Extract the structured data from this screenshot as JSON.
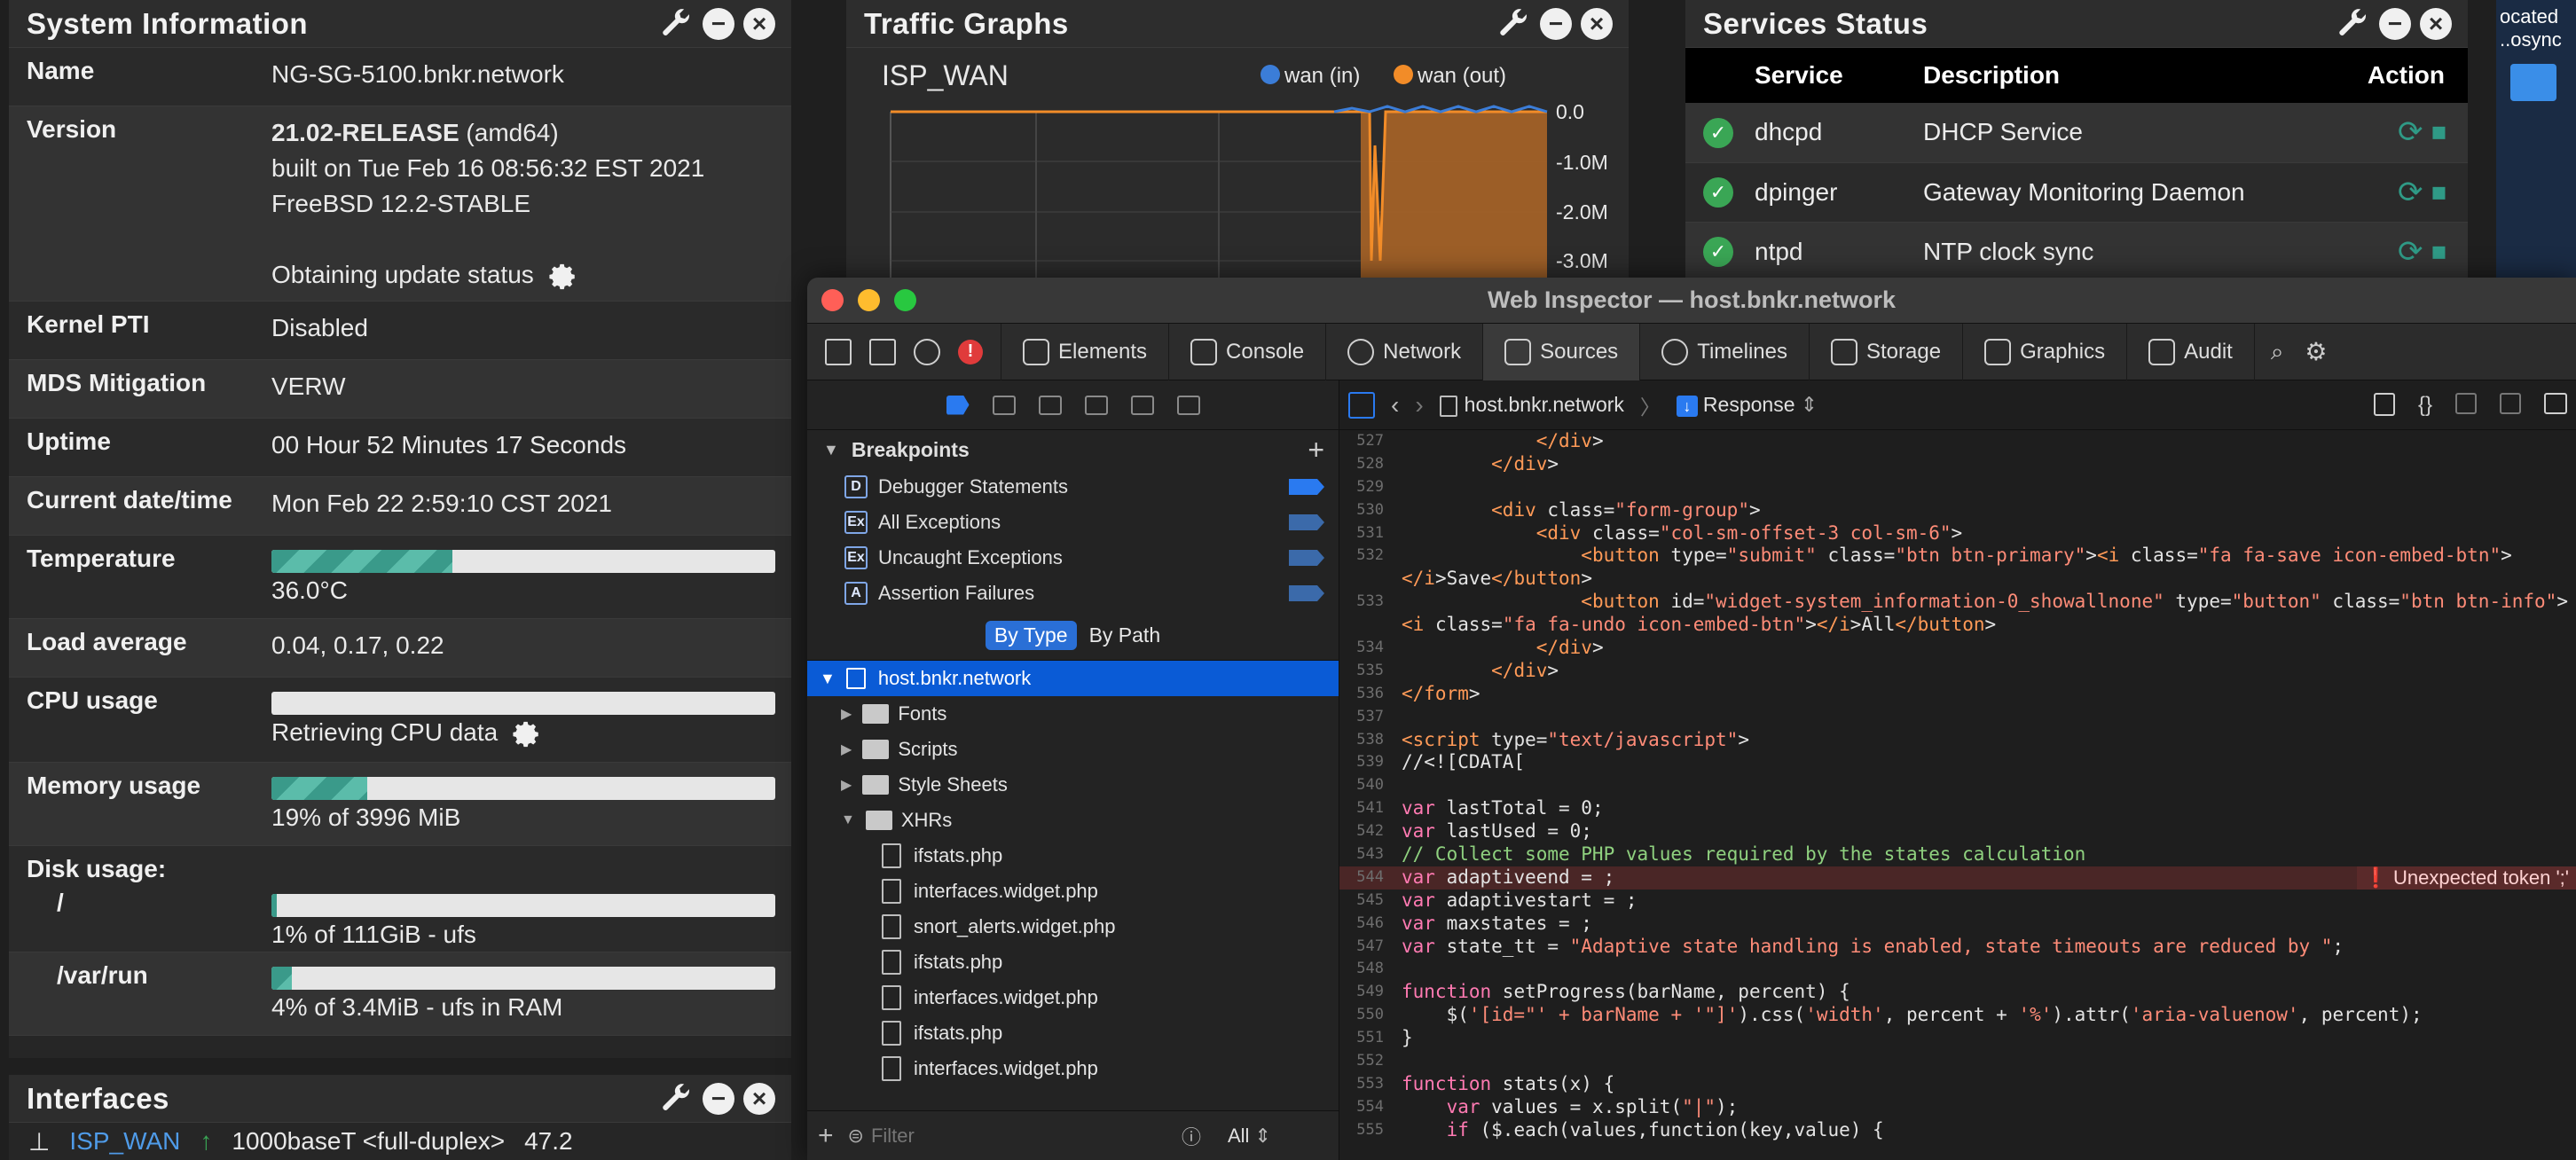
{
  "system_info": {
    "title": "System Information",
    "rows": [
      {
        "key": "Name",
        "value": "NG-SG-5100.bnkr.network"
      },
      {
        "key": "Version",
        "value_bold": "21.02-RELEASE",
        "value_suffix": " (amd64)",
        "line2": "built on Tue Feb 16 08:56:32 EST 2021",
        "line3": "FreeBSD 12.2-STABLE",
        "line4": "Obtaining update status"
      },
      {
        "key": "Kernel PTI",
        "value": "Disabled"
      },
      {
        "key": "MDS Mitigation",
        "value": "VERW"
      },
      {
        "key": "Uptime",
        "value": "00 Hour 52 Minutes 17 Seconds"
      },
      {
        "key": "Current date/time",
        "value": "Mon Feb 22 2:59:10 CST 2021"
      },
      {
        "key": "Temperature",
        "value": "36.0°C",
        "fraction": 0.36
      },
      {
        "key": "Load average",
        "value": "0.04, 0.17, 0.22"
      },
      {
        "key": "CPU usage",
        "value": "Retrieving CPU data",
        "fraction": 0
      },
      {
        "key": "Memory usage",
        "value": "19% of 3996 MiB",
        "fraction": 0.19
      },
      {
        "key": "Disk usage:",
        "sub": "/",
        "value": "1% of 111GiB - ufs",
        "fraction": 0.01
      },
      {
        "key": "/var/run",
        "value": "4% of 3.4MiB - ufs in RAM",
        "fraction": 0.04
      }
    ]
  },
  "interfaces": {
    "title": "Interfaces",
    "row_name": "ISP_WAN",
    "row_media": "1000baseT <full-duplex>",
    "row_ip": "47.2"
  },
  "traffic": {
    "title": "Traffic Graphs",
    "iface": "ISP_WAN",
    "legend_in": "wan (in)",
    "legend_out": "wan (out)",
    "ticks": [
      "0.0",
      "-1.0M",
      "-2.0M",
      "-3.0M"
    ],
    "color_in": "#3b7dd8",
    "color_out": "#f28c28"
  },
  "services": {
    "title": "Services Status",
    "headers": [
      "Service",
      "Description",
      "Action"
    ],
    "rows": [
      {
        "name": "dhcpd",
        "desc": "DHCP Service"
      },
      {
        "name": "dpinger",
        "desc": "Gateway Monitoring Daemon"
      },
      {
        "name": "ntpd",
        "desc": "NTP clock sync"
      }
    ]
  },
  "desktop": {
    "line1": "ocated",
    "line2": "..osync"
  },
  "inspector": {
    "title": "Web Inspector — host.bnkr.network",
    "tabs": [
      "Elements",
      "Console",
      "Network",
      "Sources",
      "Timelines",
      "Storage",
      "Graphics",
      "Audit"
    ],
    "breakpoints_label": "Breakpoints",
    "breakpoints": [
      {
        "badge": "D",
        "label": "Debugger Statements"
      },
      {
        "badge": "Ex",
        "label": "All Exceptions"
      },
      {
        "badge": "Ex",
        "label": "Uncaught Exceptions"
      },
      {
        "badge": "A",
        "label": "Assertion Failures"
      }
    ],
    "scope_by_type": "By Type",
    "scope_by_path": "By Path",
    "resource_root": "host.bnkr.network",
    "folders": [
      "Fonts",
      "Scripts",
      "Style Sheets",
      "XHRs"
    ],
    "xhr_files": [
      "ifstats.php",
      "interfaces.widget.php",
      "snort_alerts.widget.php",
      "ifstats.php",
      "interfaces.widget.php",
      "ifstats.php",
      "interfaces.widget.php"
    ],
    "filter_placeholder": "Filter",
    "filter_all": "All",
    "path_host": "host.bnkr.network",
    "path_response": "Response",
    "error_message": "Unexpected token ';'",
    "code_lines": [
      {
        "n": "527",
        "t": "            </div>"
      },
      {
        "n": "528",
        "t": "        </div>"
      },
      {
        "n": "529",
        "t": ""
      },
      {
        "n": "530",
        "t": "        <div class=\"form-group\">"
      },
      {
        "n": "531",
        "t": "            <div class=\"col-sm-offset-3 col-sm-6\">"
      },
      {
        "n": "532",
        "t": "                <button type=\"submit\" class=\"btn btn-primary\"><i class=\"fa fa-save icon-embed-btn\">"
      },
      {
        "n": "",
        "t": "</i>Save</button>"
      },
      {
        "n": "533",
        "t": "                <button id=\"widget-system_information-0_showallnone\" type=\"button\" class=\"btn btn-info\">"
      },
      {
        "n": "",
        "t": "<i class=\"fa fa-undo icon-embed-btn\"></i>All</button>"
      },
      {
        "n": "534",
        "t": "            </div>"
      },
      {
        "n": "535",
        "t": "        </div>"
      },
      {
        "n": "536",
        "t": "</form>"
      },
      {
        "n": "537",
        "t": ""
      },
      {
        "n": "538",
        "t": "<script type=\"text/javascript\">"
      },
      {
        "n": "539",
        "t": "//<![CDATA["
      },
      {
        "n": "540",
        "t": ""
      },
      {
        "n": "541",
        "t": "var lastTotal = 0;"
      },
      {
        "n": "542",
        "t": "var lastUsed = 0;"
      },
      {
        "n": "543",
        "t": "// Collect some PHP values required by the states calculation"
      },
      {
        "n": "544",
        "t": "var adaptiveend = ;"
      },
      {
        "n": "545",
        "t": "var adaptivestart = ;"
      },
      {
        "n": "546",
        "t": "var maxstates = ;"
      },
      {
        "n": "547",
        "t": "var state_tt = \"Adaptive state handling is enabled, state timeouts are reduced by \";"
      },
      {
        "n": "548",
        "t": ""
      },
      {
        "n": "549",
        "t": "function setProgress(barName, percent) {"
      },
      {
        "n": "550",
        "t": "    $('[id=\"' + barName + '\"]').css('width', percent + '%').attr('aria-valuenow', percent);"
      },
      {
        "n": "551",
        "t": "}"
      },
      {
        "n": "552",
        "t": ""
      },
      {
        "n": "553",
        "t": "function stats(x) {"
      },
      {
        "n": "554",
        "t": "    var values = x.split(\"|\");"
      },
      {
        "n": "555",
        "t": "    if ($.each(values,function(key,value) {"
      }
    ]
  }
}
